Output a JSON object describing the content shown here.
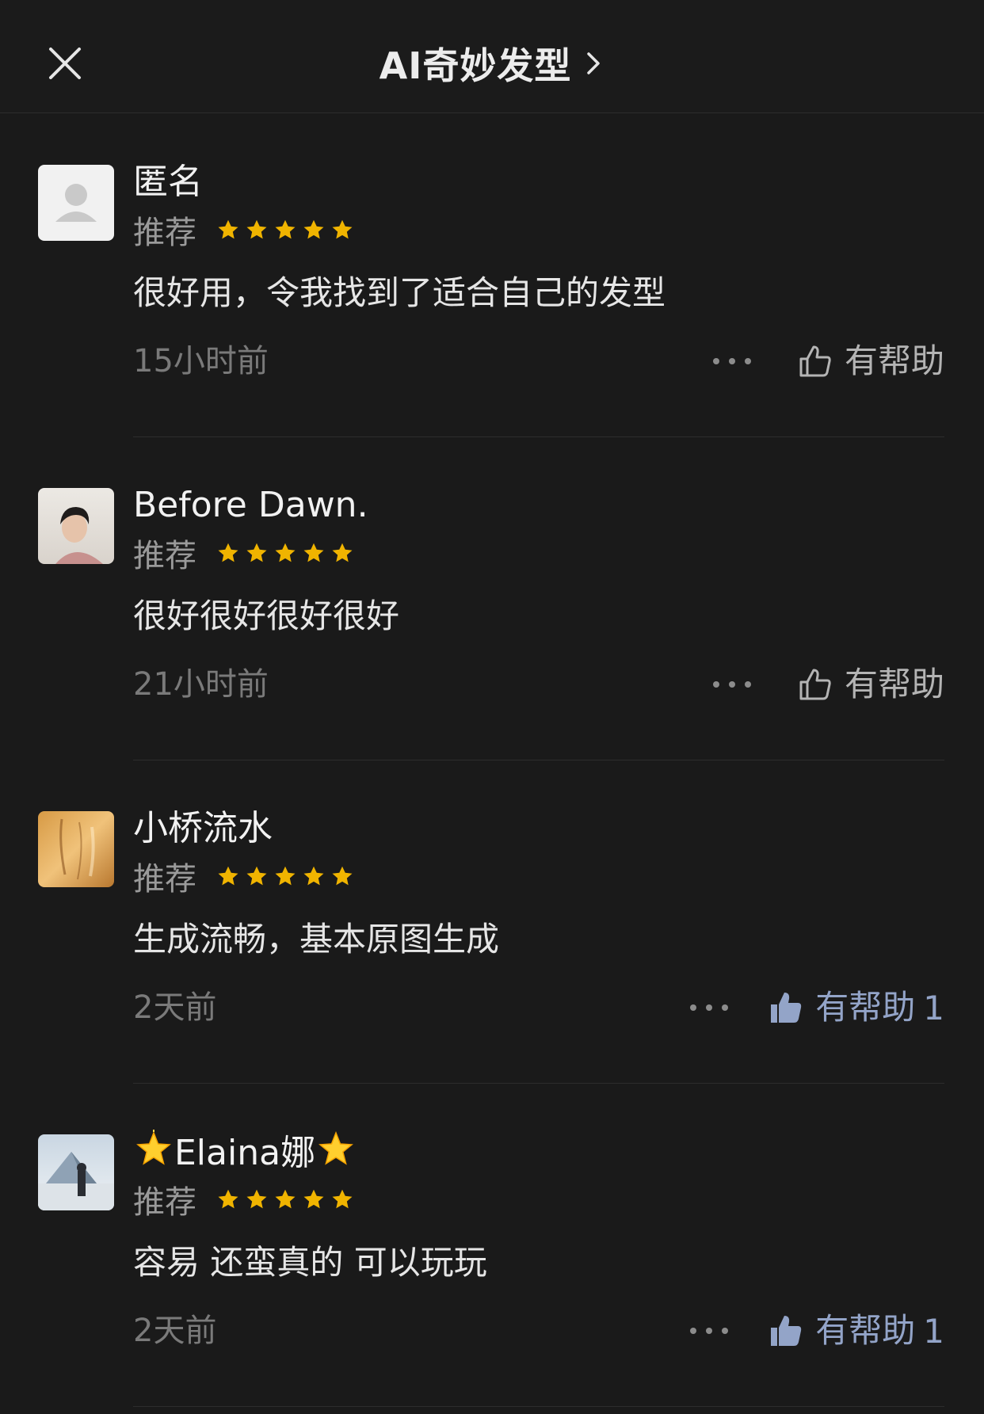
{
  "header": {
    "title": "AI奇妙发型",
    "close_icon": "close-icon",
    "chevron_icon": "chevron-right-icon"
  },
  "colors": {
    "background": "#1a1a1a",
    "star": "#f0b400",
    "helpful_active": "#93a4c8"
  },
  "reviews": [
    {
      "name": "匿名",
      "rating_label": "推荐",
      "stars": 5,
      "text": "很好用，令我找到了适合自己的发型",
      "time": "15小时前",
      "helpful_label": "有帮助",
      "helpful_count": "",
      "helpful_active": false,
      "avatar": "default-user-avatar"
    },
    {
      "name": "Before Dawn.",
      "rating_label": "推荐",
      "stars": 5,
      "text": "很好很好很好很好",
      "time": "21小时前",
      "helpful_label": "有帮助",
      "helpful_count": "",
      "helpful_active": false,
      "avatar": "photo-avatar-person"
    },
    {
      "name": "小桥流水",
      "rating_label": "推荐",
      "stars": 5,
      "text": "生成流畅，基本原图生成",
      "time": "2天前",
      "helpful_label": "有帮助",
      "helpful_count": "1",
      "helpful_active": true,
      "avatar": "photo-avatar-warm-light"
    },
    {
      "name": "Elaina娜",
      "rating_label": "推荐",
      "stars": 5,
      "text": "容易 还蛮真的 可以玩玩",
      "time": "2天前",
      "helpful_label": "有帮助",
      "helpful_count": "1",
      "helpful_active": true,
      "avatar": "photo-avatar-pyramid"
    }
  ]
}
